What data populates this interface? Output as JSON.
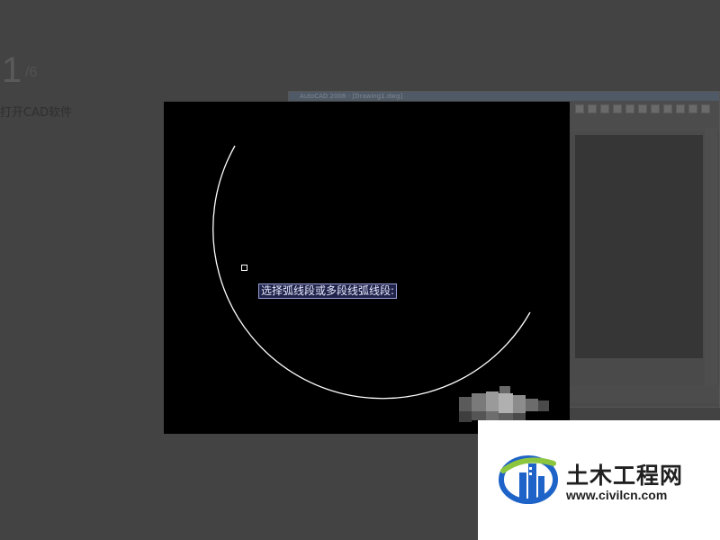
{
  "tutorial": {
    "step_number": "1",
    "step_total": "/6",
    "step_text": "打开CAD软件"
  },
  "cad_window": {
    "title": "AutoCAD 2008 - [Drawing1.dwg]"
  },
  "command_prompt": {
    "text": "选择弧线段或多段线弧线段:"
  },
  "watermark": {
    "name_cn": "土木工程网",
    "url": "www.civilcn.com"
  },
  "colors": {
    "page_background": "#434343",
    "canvas_background": "#000000",
    "arc_stroke": "#ffffff",
    "prompt_background": "#20234a",
    "logo_blue": "#1e63c8",
    "logo_green": "#8cc63f"
  }
}
